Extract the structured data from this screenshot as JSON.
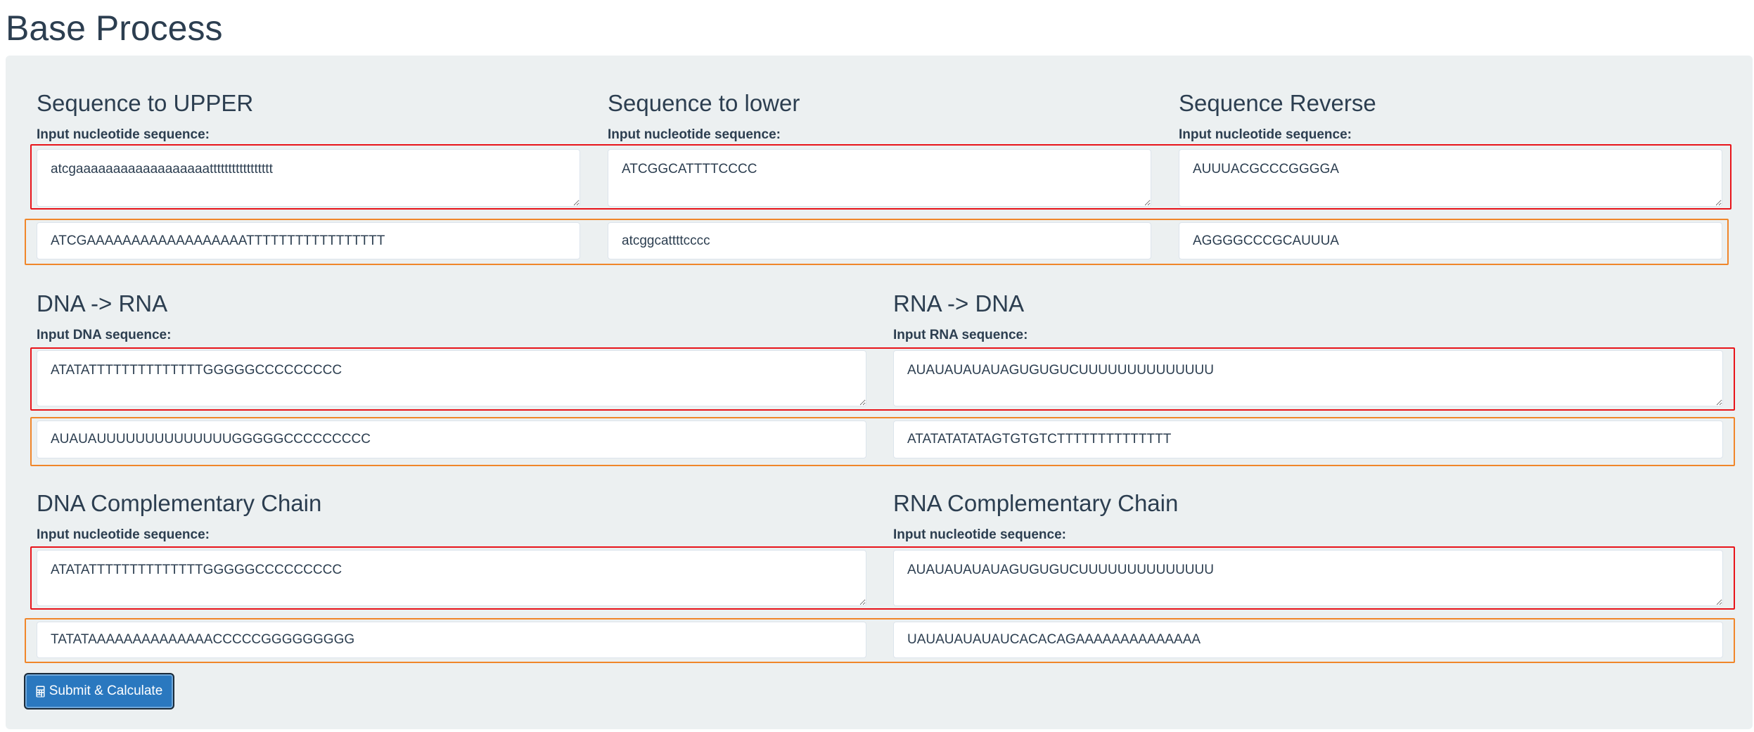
{
  "page": {
    "title": "Base Process"
  },
  "sections": {
    "upper": {
      "title": "Sequence to UPPER",
      "label": "Input nucleotide sequence:",
      "input": "atcgaaaaaaaaaaaaaaaaaattttttttttttttttt",
      "output": "ATCGAAAAAAAAAAAAAAAAAATTTTTTTTTTTTTTTTT"
    },
    "lower": {
      "title": "Sequence to lower",
      "label": "Input nucleotide sequence:",
      "input": "ATCGGCATTTTCCCC",
      "output": "atcggcattttcccc"
    },
    "reverse": {
      "title": "Sequence Reverse",
      "label": "Input nucleotide sequence:",
      "input": "AUUUACGCCCGGGGA",
      "output": "AGGGGCCCGCAUUUA"
    },
    "dna_to_rna": {
      "title": "DNA -> RNA",
      "label": "Input DNA sequence:",
      "input": "ATATATTTTTTTTTTTTTTGGGGGCCCCCCCCC",
      "output": "AUAUAUUUUUUUUUUUUUUGGGGGCCCCCCCCC"
    },
    "rna_to_dna": {
      "title": "RNA -> DNA",
      "label": "Input RNA sequence:",
      "input": "AUAUAUAUAUAGUGUGUCUUUUUUUUUUUUUU",
      "output": "ATATATATATAGTGTGTCTTTTTTTTTTTTTT"
    },
    "dna_complement": {
      "title": "DNA Complementary Chain",
      "label": "Input nucleotide sequence:",
      "input": "ATATATTTTTTTTTTTTTTGGGGGCCCCCCCCC",
      "output": "TATATAAAAAAAAAAAAAACCCCCGGGGGGGGG"
    },
    "rna_complement": {
      "title": "RNA Complementary Chain",
      "label": "Input nucleotide sequence:",
      "input": "AUAUAUAUAUAGUGUGUCUUUUUUUUUUUUUU",
      "output": "UAUAUAUAUAUCACACAGAAAAAAAAAAAAAA"
    }
  },
  "submit": {
    "label": "Submit & Calculate",
    "icon": "calculator-icon"
  },
  "colors": {
    "title": "#2c3e50",
    "panel": "#ecf0f1",
    "button": "#2a78bf",
    "highlight_input": "#e8141a",
    "highlight_output": "#f0862a"
  }
}
